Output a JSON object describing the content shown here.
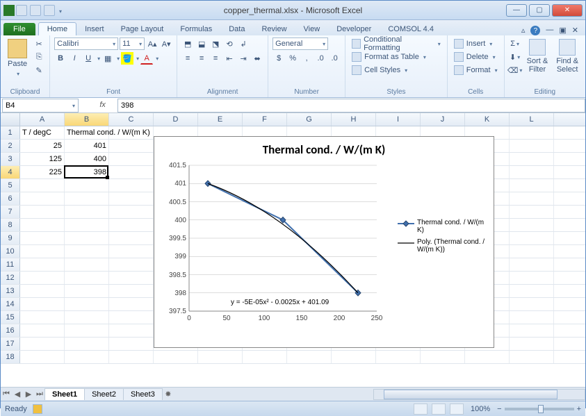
{
  "window": {
    "title": "copper_thermal.xlsx - Microsoft Excel"
  },
  "tabs": {
    "file": "File",
    "list": [
      "Home",
      "Insert",
      "Page Layout",
      "Formulas",
      "Data",
      "Review",
      "View",
      "Developer",
      "COMSOL 4.4"
    ],
    "active": "Home"
  },
  "ribbon": {
    "clipboard": {
      "label": "Clipboard",
      "paste": "Paste"
    },
    "font": {
      "label": "Font",
      "name": "Calibri",
      "size": "11",
      "bold": "B",
      "italic": "I",
      "underline": "U"
    },
    "alignment": {
      "label": "Alignment"
    },
    "number": {
      "label": "Number",
      "format": "General"
    },
    "styles": {
      "label": "Styles",
      "cond": "Conditional Formatting",
      "table": "Format as Table",
      "cell": "Cell Styles"
    },
    "cells": {
      "label": "Cells",
      "insert": "Insert",
      "delete": "Delete",
      "format": "Format"
    },
    "editing": {
      "label": "Editing",
      "sort": "Sort &\nFilter",
      "find": "Find &\nSelect"
    }
  },
  "namebox": "B4",
  "formula": "398",
  "columns": [
    "A",
    "B",
    "C",
    "D",
    "E",
    "F",
    "G",
    "H",
    "I",
    "J",
    "K",
    "L"
  ],
  "sel_col": "B",
  "sel_row": 4,
  "data": {
    "A1": "T / degC",
    "B1": "Thermal cond. / W/(m K)",
    "A2": "25",
    "B2": "401",
    "A3": "125",
    "B3": "400",
    "A4": "225",
    "B4": "398"
  },
  "chart_data": {
    "type": "line",
    "title": "Thermal cond. / W/(m K)",
    "x": [
      25,
      125,
      225
    ],
    "series": [
      {
        "name": "Thermal cond. / W/(m K)",
        "values": [
          401,
          400,
          398
        ]
      }
    ],
    "trendline": {
      "name": "Poly. (Thermal cond. / W/(m K))",
      "equation": "y = -5E-05x² - 0.0025x + 401.09"
    },
    "xlim": [
      0,
      250
    ],
    "ylim": [
      397.5,
      401.5
    ],
    "xticks": [
      0,
      50,
      100,
      150,
      200,
      250
    ],
    "yticks": [
      397.5,
      398,
      398.5,
      399,
      399.5,
      400,
      400.5,
      401,
      401.5
    ]
  },
  "sheets": {
    "list": [
      "Sheet1",
      "Sheet2",
      "Sheet3"
    ],
    "active": "Sheet1"
  },
  "status": {
    "ready": "Ready",
    "zoom": "100%"
  }
}
